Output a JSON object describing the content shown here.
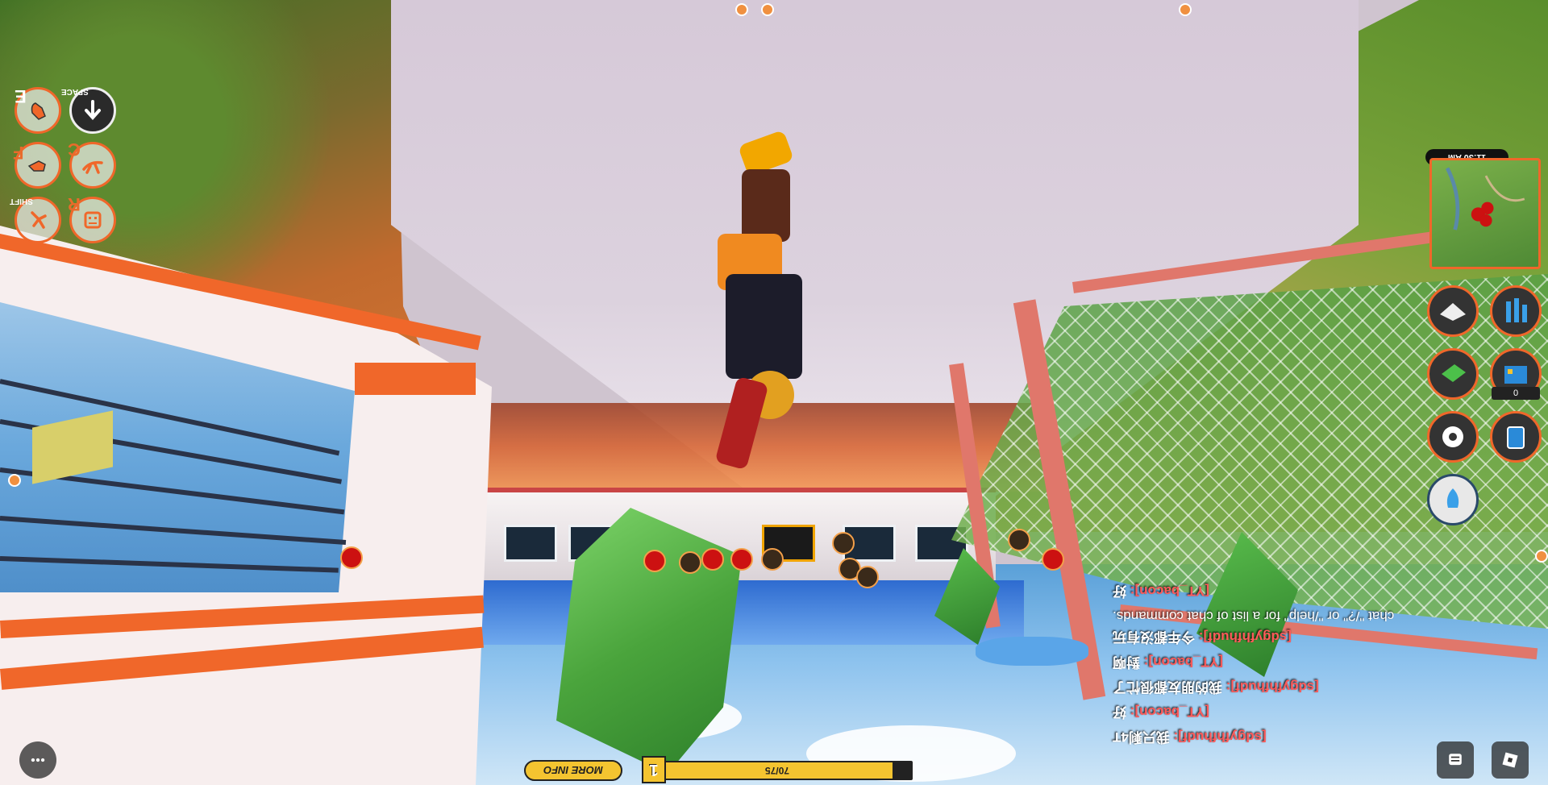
{
  "hud": {
    "keys": {
      "interact": "E",
      "jump": "SPACE",
      "f_key": "F",
      "c_key": "C",
      "shift_key": "SHIFT",
      "r_key": "R"
    },
    "clock": "11:30 AM",
    "inventory_count": "0",
    "more_info": "MORE INFO",
    "level": "1",
    "xp_text": "70/75",
    "xp_fraction": 0.93
  },
  "chat": {
    "lines": [
      {
        "name": "[sdgyfhfhudf]:",
        "text": "我只剩4T"
      },
      {
        "name": "[YT_bacon]:",
        "text": "好"
      },
      {
        "name": "[sdgyfhfhudf]:",
        "text": "我的朋友都很忙了"
      },
      {
        "name": "[YT_bacon]:",
        "text": "對啊"
      },
      {
        "name": "[sdgyfhfhudf]:",
        "text": "今年都沒有玩"
      },
      {
        "name": "",
        "text": "chat \"/?\" or \"/help\" for a list of chat commands."
      },
      {
        "name": "[YT_bacon]:",
        "text": "好"
      }
    ]
  },
  "colors": {
    "accent": "#f0672a",
    "marker_red": "#cc1111",
    "xp_yellow": "#f4c430"
  },
  "icons": [
    "hand-interact-icon",
    "arrow-down-jump-icon",
    "punch-icon",
    "crawl-icon",
    "sprint-icon",
    "robot-face-icon",
    "menu-dots-icon",
    "chat-icon",
    "roblox-logo-icon"
  ]
}
